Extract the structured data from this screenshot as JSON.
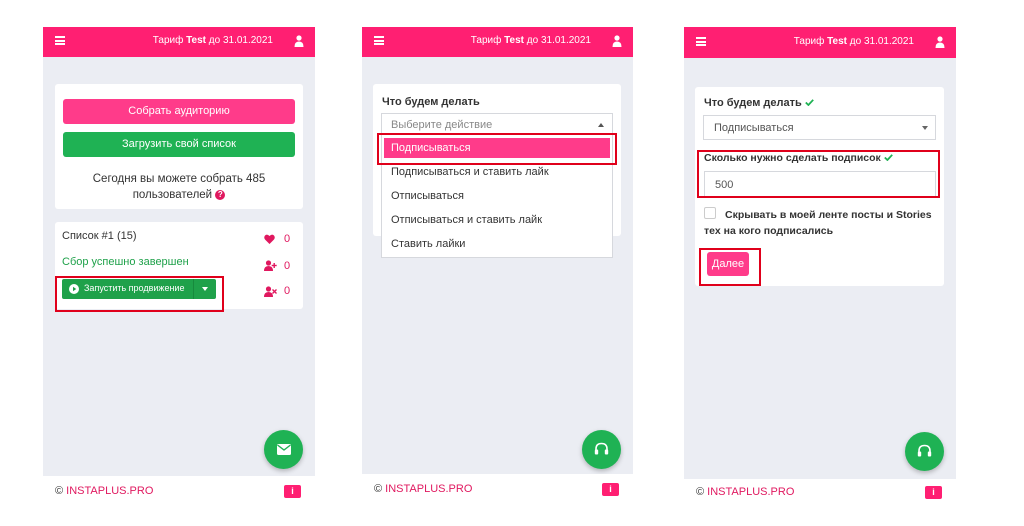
{
  "topbar": {
    "tariff_prefix": "Тариф",
    "tariff_plan": "Test",
    "tariff_suffix": "до 31.01.2021"
  },
  "footer": {
    "copyright": "©",
    "brand": "INSTAPLUS.PRO",
    "info_label": "i"
  },
  "screen1": {
    "collect_button": "Собрать аудиторию",
    "upload_button": "Загрузить свой список",
    "today_text_line1": "Сегодня вы можете собрать 485",
    "today_text_line2": "пользователей",
    "help_icon": "?",
    "list_title": "Список #1 (15)",
    "status": "Сбор успешно завершен",
    "start_button": "Запустить продвижение",
    "counters": {
      "likes": "0",
      "follows": "0",
      "unfollows": "0"
    }
  },
  "screen2": {
    "label": "Что будем делать",
    "placeholder": "Выберите действие",
    "options": [
      "Подписываться",
      "Подписываться и ставить лайк",
      "Отписываться",
      "Отписываться и ставить лайк",
      "Ставить лайки"
    ]
  },
  "screen3": {
    "label_action": "Что будем делать",
    "selected_action": "Подписываться",
    "label_count": "Сколько нужно сделать подписок",
    "count_value": "500",
    "checkbox_line1": "Скрывать в моей ленте посты и Stories",
    "checkbox_line2": "тех на кого подписались",
    "next_button": "Далее"
  },
  "colors": {
    "accent_pink": "#ff1f72",
    "green": "#1fb254",
    "highlight_red": "#e0001b",
    "background": "#ebedf3"
  },
  "icons": [
    "menu-icon",
    "user-icon",
    "heart-icon",
    "add-user-icon",
    "remove-user-icon",
    "play-icon",
    "caret-down-icon",
    "envelope-icon",
    "headphones-icon",
    "check-icon",
    "info-icon",
    "question-icon"
  ]
}
